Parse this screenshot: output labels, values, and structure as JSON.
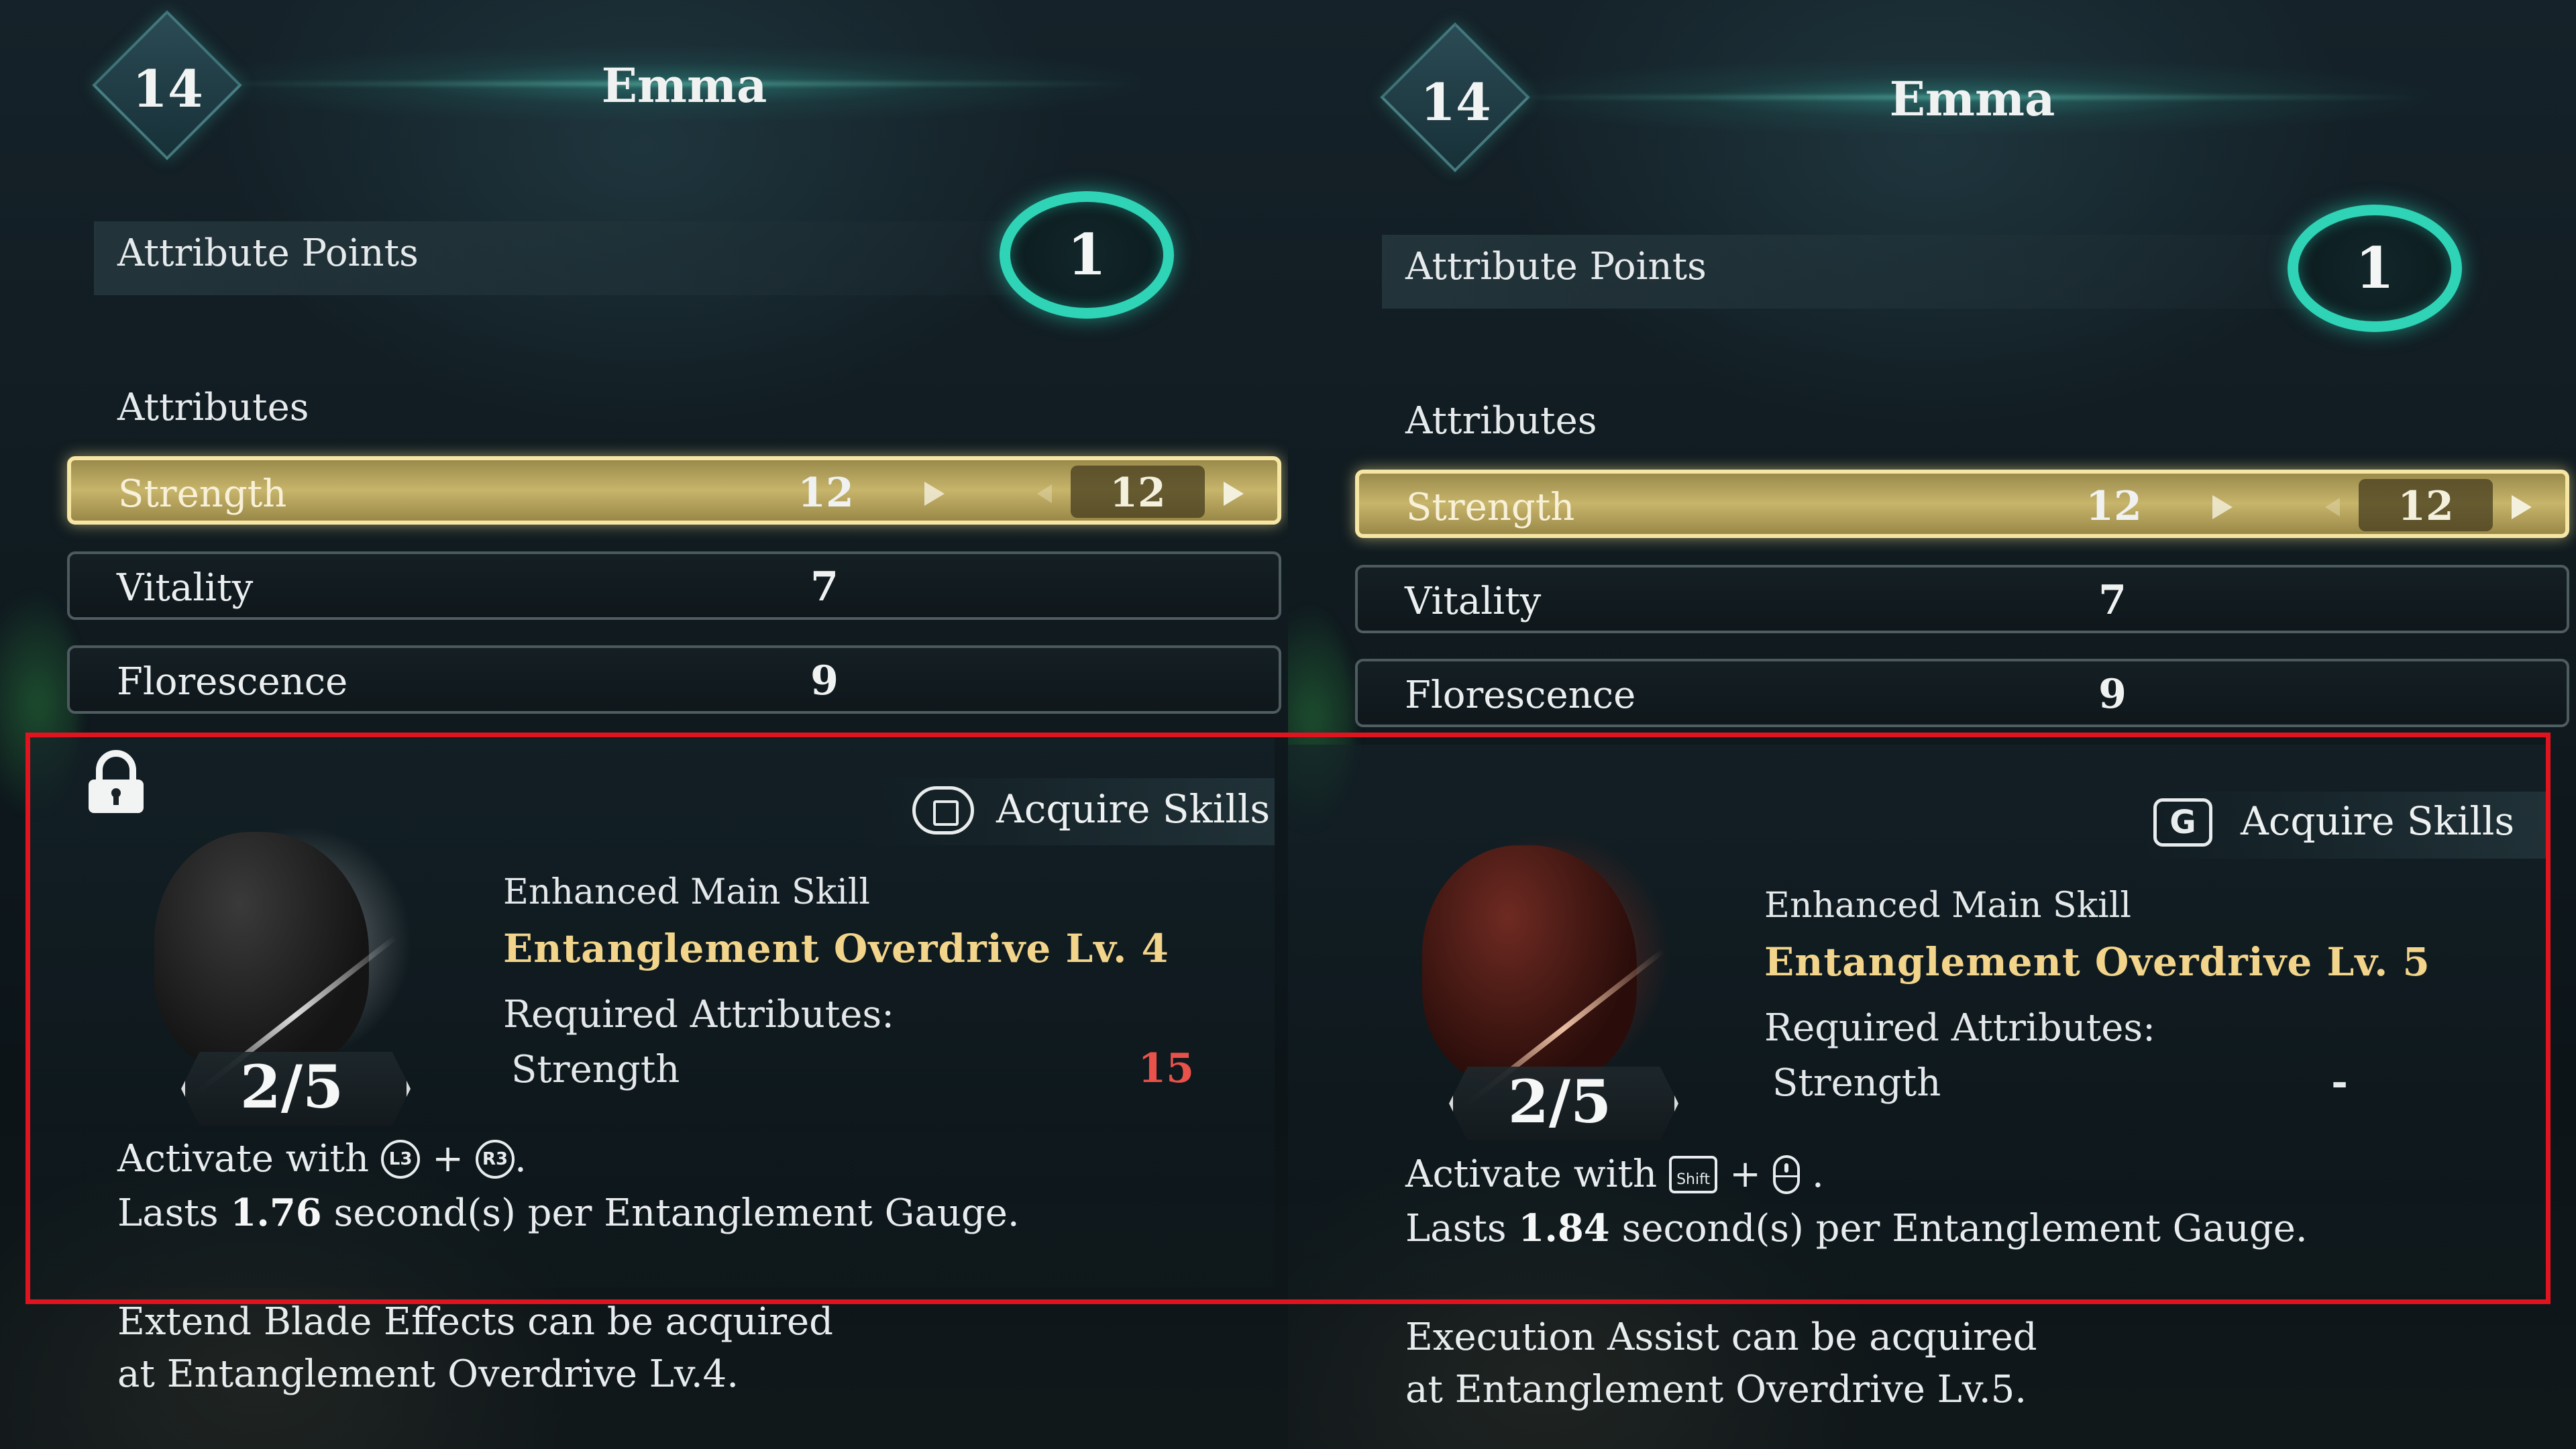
{
  "colors": {
    "accent_teal": "#2fd3b6",
    "selected_row": "#c7b56b",
    "skill_name": "#f2d48a",
    "requirement_unmet": "#e8524a",
    "highlight_box": "#e0141e"
  },
  "panels": [
    {
      "header": {
        "level": "14",
        "name": "Emma"
      },
      "attribute_points": {
        "label": "Attribute Points",
        "value": "1"
      },
      "attributes_heading": "Attributes",
      "attributes": [
        {
          "name": "Strength",
          "value": "12",
          "next_value": "12",
          "selected": true
        },
        {
          "name": "Vitality",
          "value": "7"
        },
        {
          "name": "Florescence",
          "value": "9"
        }
      ],
      "acquire": {
        "button_icon": "square-button-icon",
        "label": "Acquire Skills"
      },
      "skill": {
        "locked": true,
        "rank": "2/5",
        "type": "Enhanced Main Skill",
        "name": "Entanglement Overdrive Lv. 4",
        "required_label": "Required Attributes:",
        "required_attribute": "Strength",
        "required_value": "15",
        "required_value_color": "#e8524a",
        "activate_prefix": "Activate with",
        "input_a": "L3",
        "input_b": "R3",
        "input_type": "gamepad",
        "plus": "+",
        "period": ".",
        "lasts_prefix": "Lasts",
        "lasts_value": "1.76",
        "lasts_suffix": "second(s) per Entanglement Gauge."
      },
      "footer_line1": "Extend Blade Effects can be acquired",
      "footer_line2": "at Entanglement Overdrive Lv.4."
    },
    {
      "header": {
        "level": "14",
        "name": "Emma"
      },
      "attribute_points": {
        "label": "Attribute Points",
        "value": "1"
      },
      "attributes_heading": "Attributes",
      "attributes": [
        {
          "name": "Strength",
          "value": "12",
          "next_value": "12",
          "selected": true
        },
        {
          "name": "Vitality",
          "value": "7"
        },
        {
          "name": "Florescence",
          "value": "9"
        }
      ],
      "acquire": {
        "button_icon": "g-key-icon",
        "key": "G",
        "label": "Acquire Skills"
      },
      "skill": {
        "locked": false,
        "rank": "2/5",
        "type": "Enhanced Main Skill",
        "name": "Entanglement Overdrive Lv. 5",
        "required_label": "Required Attributes:",
        "required_attribute": "Strength",
        "required_value": "-",
        "required_value_color": "#e8ecee",
        "activate_prefix": "Activate with",
        "input_a": "Shift",
        "input_b": "mouse-middle",
        "input_type": "keyboard",
        "plus": "+",
        "period": ".",
        "lasts_prefix": "Lasts",
        "lasts_value": "1.84",
        "lasts_suffix": "second(s) per Entanglement Gauge."
      },
      "footer_line1": "Execution Assist can be acquired",
      "footer_line2": "at Entanglement Overdrive Lv.5."
    }
  ]
}
